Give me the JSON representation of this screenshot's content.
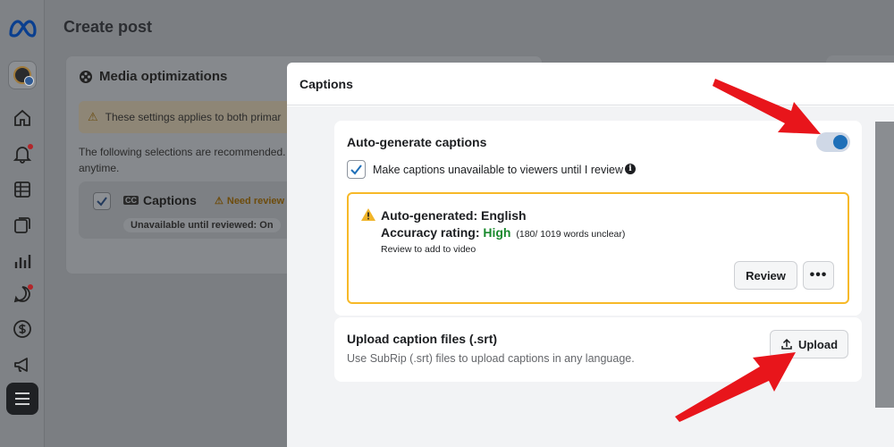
{
  "page": {
    "title": "Create post"
  },
  "media_card": {
    "title": "Media optimizations",
    "warning": "These settings applies to both primar",
    "description": "The following selections are recommended.",
    "description_2": "anytime.",
    "captions_label": "Captions",
    "need_review": "Need review",
    "unavailable_badge": "Unavailable until reviewed: On"
  },
  "modal": {
    "title": "Captions",
    "auto_generate": {
      "title": "Auto-generate captions",
      "toggle_on": true,
      "checkbox_label": "Make captions unavailable to viewers until I review",
      "checkbox_checked": true
    },
    "alert": {
      "line1": "Auto-generated: English",
      "rating_label": "Accuracy rating: ",
      "rating_value": "High",
      "rating_detail": "(180/ 1019 words unclear)",
      "hint": "Review to add to video",
      "review_button": "Review",
      "more_button": "•••"
    },
    "upload": {
      "title": "Upload caption files (.srt)",
      "subtitle": "Use SubRip (.srt) files to upload captions in any language.",
      "button": "Upload"
    }
  },
  "colors": {
    "toggle_accent": "#1e6fb8",
    "alert_border": "#f7b928",
    "high_rating": "#1a8a2e",
    "annotation_arrow": "#e8151b"
  },
  "sidebar_icons": [
    "meta-logo-icon",
    "avatar",
    "home-icon",
    "bell-icon",
    "table-icon",
    "pages-icon",
    "insights-icon",
    "chat-icon",
    "dollar-icon",
    "megaphone-icon",
    "menu-icon"
  ]
}
